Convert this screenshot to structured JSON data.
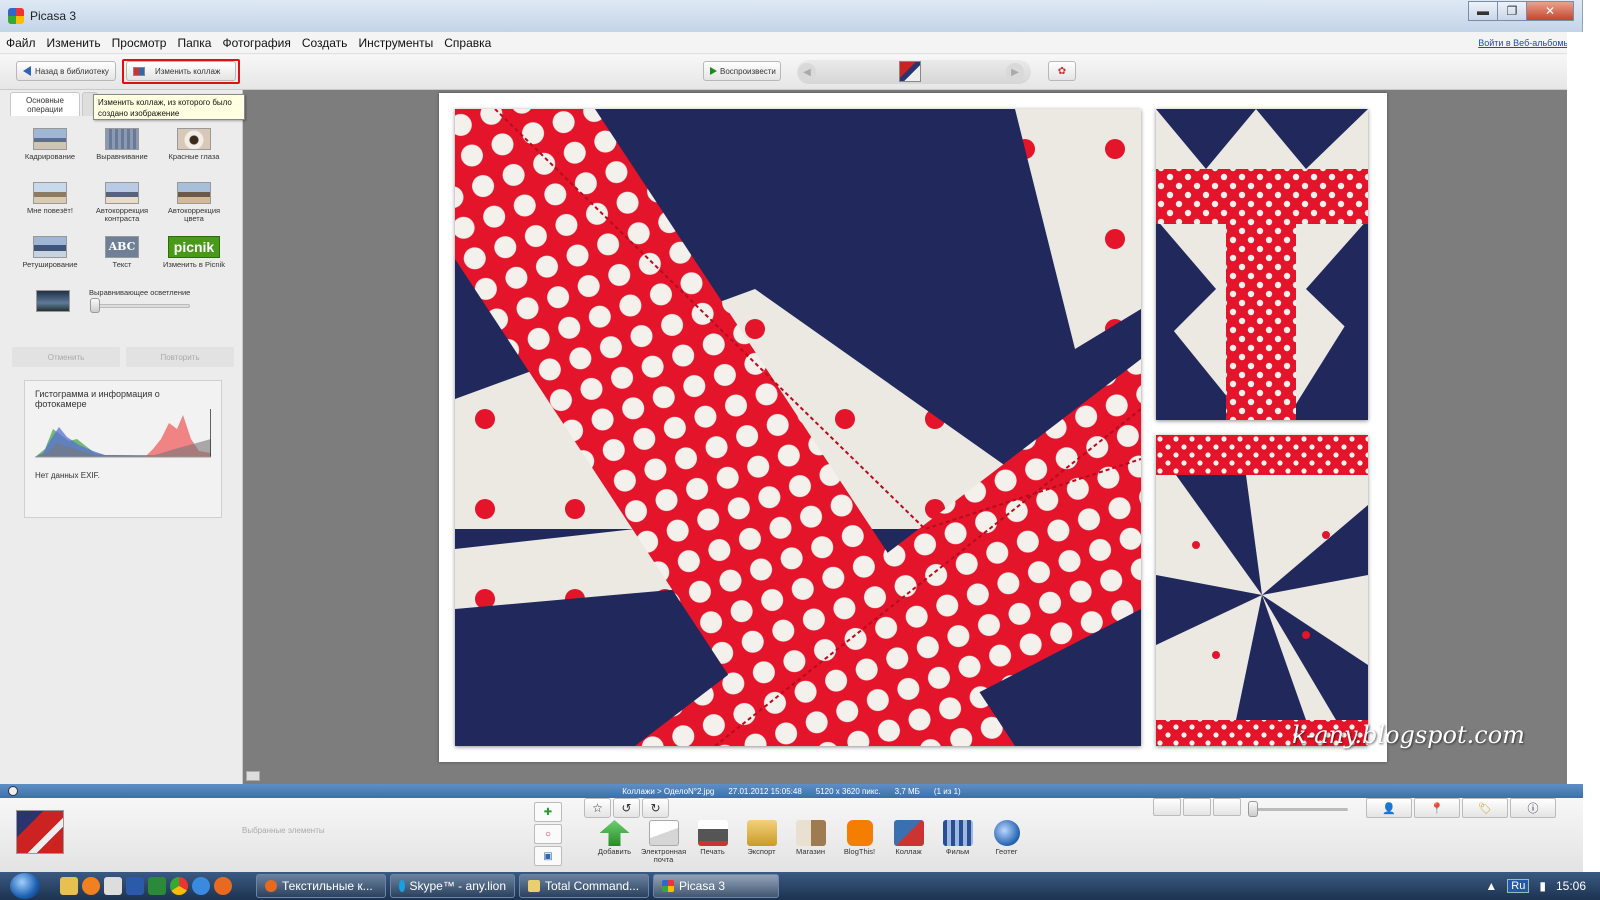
{
  "window": {
    "title": "Picasa 3",
    "min_label": "▬",
    "max_label": "❐",
    "close_label": "✕"
  },
  "menu": [
    "Файл",
    "Изменить",
    "Просмотр",
    "Папка",
    "Фотография",
    "Создать",
    "Инструменты",
    "Справка"
  ],
  "web_albums_link": "Войти в Веб-альбомы",
  "toolbar": {
    "back_label": "Назад в библиотеку",
    "edit_collage_label": "Изменить коллаж",
    "play_label": "Воспроизвести"
  },
  "tooltip": "Изменить коллаж, из которого было создано изображение",
  "tabs": {
    "basic": "Основные операции"
  },
  "tools": [
    {
      "label": "Кадрирование",
      "icon": "crop-icon"
    },
    {
      "label": "Выравнивание",
      "icon": "straighten-icon"
    },
    {
      "label": "Красные глаза",
      "icon": "red-eye-icon"
    },
    {
      "label": "Мне повезёт!",
      "icon": "lucky-icon"
    },
    {
      "label": "Автокоррекция контраста",
      "icon": "auto-contrast-icon"
    },
    {
      "label": "Автокоррекция цвета",
      "icon": "auto-color-icon"
    },
    {
      "label": "Ретуширование",
      "icon": "retouch-icon"
    },
    {
      "label": "Текст",
      "icon": "text-icon",
      "glyph": "ABC"
    },
    {
      "label": "Изменить в Picnik",
      "icon": "picnik-icon",
      "glyph": "picnik"
    }
  ],
  "fill_light": {
    "label": "Выравнивающее осветление",
    "value": 0
  },
  "undo_label": "Отменить",
  "redo_label": "Повторить",
  "histogram": {
    "title": "Гистограмма и информация о фотокамере",
    "exif": "Нет данных EXIF."
  },
  "watermark": "k-any.blogspot.com",
  "status": {
    "path": "Коллажи > ОделоN°2.jpg",
    "date": "27.01.2012 15:05:48",
    "dims": "5120 x 3620 пикс.",
    "size": "3,7 МБ",
    "count": "(1 из 1)"
  },
  "tray": {
    "selected_label": "Выбранные элементы"
  },
  "actions": [
    {
      "label": "Добавить",
      "icon": "upload-icon",
      "color": "#3aa53a"
    },
    {
      "label": "Электронная почта",
      "icon": "email-icon",
      "color": "#e8e8e8"
    },
    {
      "label": "Печать",
      "icon": "print-icon",
      "color": "#555555"
    },
    {
      "label": "Экспорт",
      "icon": "export-folder-icon",
      "color": "#e2b84a"
    },
    {
      "label": "Магазин",
      "icon": "shop-icon",
      "color": "#b0a488"
    },
    {
      "label": "BlogThis!",
      "icon": "blogger-icon",
      "color": "#f57d00"
    },
    {
      "label": "Коллаж",
      "icon": "collage-icon",
      "color": "#3a6fb0"
    },
    {
      "label": "Фильм",
      "icon": "movie-icon",
      "color": "#5a7fc0"
    },
    {
      "label": "Геотег",
      "icon": "geotag-icon",
      "color": "#2060b0"
    }
  ],
  "taskbar": {
    "tasks": [
      "Текстильные к...",
      "Skype™ - any.lion",
      "Total Command...",
      "Picasa 3"
    ],
    "lang": "Ru",
    "clock": "15:06"
  }
}
